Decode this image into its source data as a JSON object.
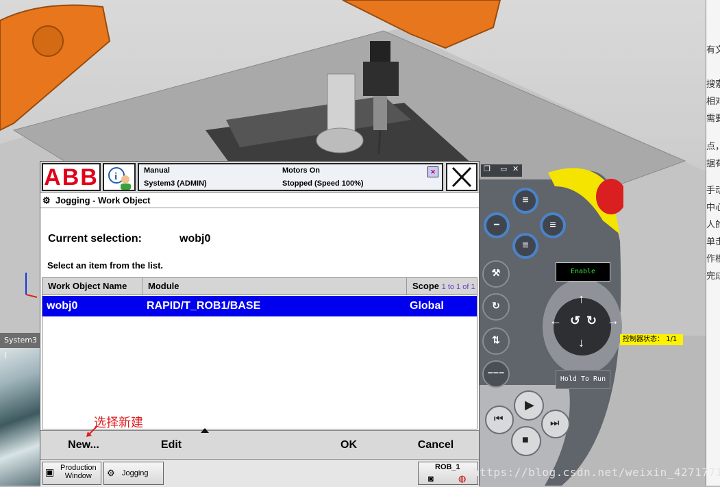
{
  "header": {
    "mode": "Manual",
    "system": "System3 (ADMIN)",
    "motors": "Motors On",
    "state": "Stopped (Speed 100%)",
    "logo_text": "ABB"
  },
  "view": {
    "breadcrumb": "Jogging - Work Object",
    "current_selection_label": "Current selection:",
    "current_selection_value": "wobj0",
    "hint": "Select an item from the list."
  },
  "table": {
    "columns": [
      "Work Object Name",
      "Module",
      "Scope"
    ],
    "scope_range": "1 to 1 of 1",
    "rows": [
      {
        "name": "wobj0",
        "module": "RAPID/T_ROB1/BASE",
        "scope": "Global",
        "selected": true
      }
    ]
  },
  "commands": {
    "new": "New...",
    "edit": "Edit",
    "ok": "OK",
    "cancel": "Cancel"
  },
  "taskbar": {
    "production": "Production\nWindow",
    "jogging": "Jogging",
    "robot": "ROB_1"
  },
  "pendant": {
    "enable": "Enable",
    "hold_to_run": "Hold To Run"
  },
  "background": {
    "system_tab": "System3 (",
    "controller_status": "控制器状态： 1/1",
    "doc_fragments": [
      "有文章",
      "搜索及",
      "相对",
      "需要",
      "点，",
      "据有",
      "手动",
      "中心",
      "人的",
      "单击",
      "作模",
      "完成"
    ]
  },
  "annotation": "选择新建",
  "watermark": "https://blog.csdn.net/weixin_42717711",
  "colors": {
    "selection": "#0000ee",
    "abb_red": "#e2001a",
    "pendant_blue": "#4b83c9"
  }
}
